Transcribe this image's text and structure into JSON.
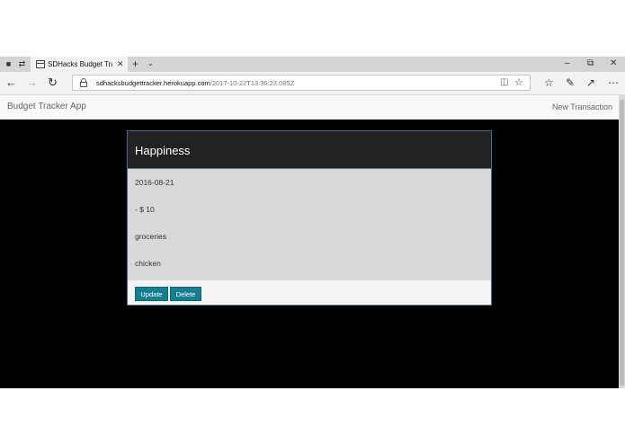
{
  "browser": {
    "tab_title": "SDHacks Budget Tracke",
    "address_host": "sdhacksbudgettracker.herokuapp.com",
    "address_path": "/2017-10-22T13:36:23.085Z"
  },
  "app": {
    "brand": "Budget Tracker App",
    "nav_new_transaction": "New Transaction"
  },
  "transaction": {
    "title": "Happiness",
    "date": "2016-08-21",
    "amount": "- $ 10",
    "category": "groceries",
    "description": "chicken",
    "update_label": "Update",
    "delete_label": "Delete"
  },
  "colors": {
    "page_background": "#000000",
    "card_header": "#222222",
    "card_body": "#d9d9d9",
    "button": "#177e8f"
  }
}
